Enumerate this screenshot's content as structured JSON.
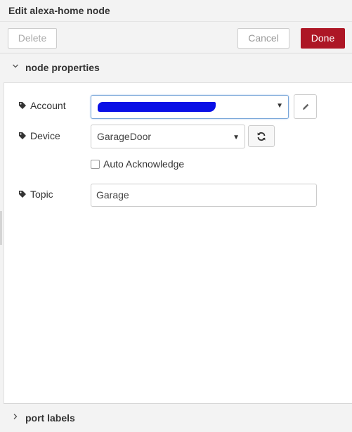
{
  "window": {
    "title": "Edit alexa-home node"
  },
  "toolbar": {
    "delete_label": "Delete",
    "cancel_label": "Cancel",
    "done_label": "Done"
  },
  "sections": {
    "node_properties": "node properties",
    "port_labels": "port labels"
  },
  "form": {
    "account": {
      "label": "Account",
      "value": ""
    },
    "device": {
      "label": "Device",
      "value": "GarageDoor"
    },
    "auto_ack": {
      "label": "Auto Acknowledge",
      "checked": false
    },
    "topic": {
      "label": "Topic",
      "value": "Garage"
    }
  },
  "icons": {
    "tag": "tag-icon",
    "edit": "pencil-icon",
    "refresh": "refresh-icon",
    "expanded": "chevron-down-icon",
    "collapsed": "chevron-right-icon",
    "select": "caret-down-icon"
  },
  "colors": {
    "primary_button": "#ad1625",
    "redaction": "#0a10e6",
    "focus_border": "#7aa7d9"
  }
}
